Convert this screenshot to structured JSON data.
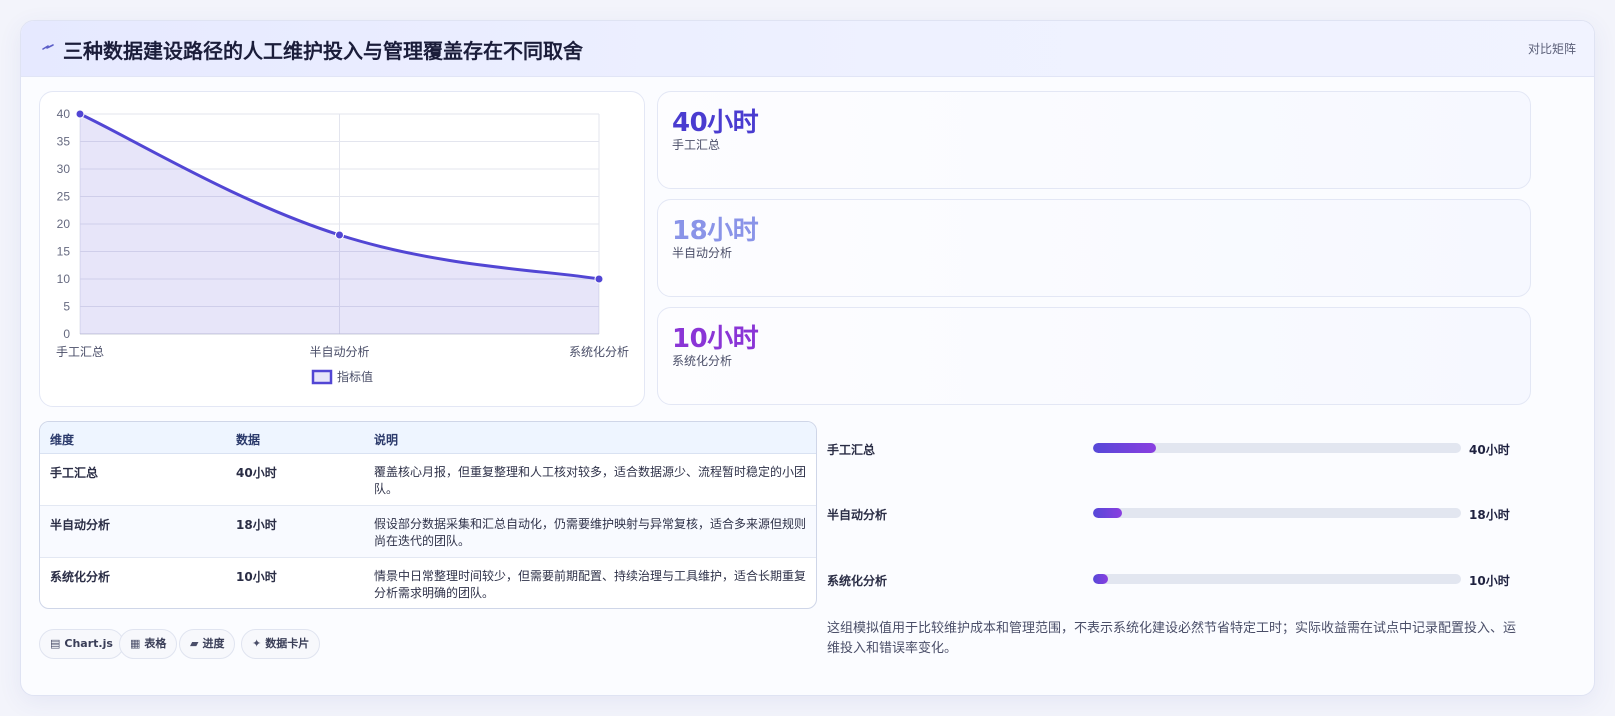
{
  "header": {
    "icon": "bolt-icon",
    "title": "三种数据建设路径的人工维护投入与管理覆盖存在不同取舍",
    "tag": "对比矩阵"
  },
  "chart_data": {
    "type": "line",
    "categories": [
      "手工汇总",
      "半自动分析",
      "系统化分析"
    ],
    "series": [
      {
        "name": "指标值",
        "values": [
          40,
          18,
          10
        ],
        "color": "#5246d4",
        "fill": "rgba(82,70,212,0.14)"
      }
    ],
    "yticks": [
      0,
      5,
      10,
      15,
      20,
      25,
      30,
      35,
      40
    ],
    "ylim": [
      0,
      40
    ],
    "grid": true,
    "legend_position": "bottom"
  },
  "stats": [
    {
      "value": "40小时",
      "label": "手工汇总",
      "color": "#4a3cd0"
    },
    {
      "value": "18小时",
      "label": "半自动分析",
      "color": "#8a94e8"
    },
    {
      "value": "10小时",
      "label": "系统化分析",
      "color": "#8a35d6"
    }
  ],
  "table": {
    "headers": [
      "维度",
      "数据",
      "说明"
    ],
    "rows": [
      {
        "dim": "手工汇总",
        "data": "40小时",
        "desc": "覆盖核心月报，但重复整理和人工核对较多，适合数据源少、流程暂时稳定的小团队。"
      },
      {
        "dim": "半自动分析",
        "data": "18小时",
        "desc": "假设部分数据采集和汇总自动化，仍需要维护映射与异常复核，适合多来源但规则尚在迭代的团队。"
      },
      {
        "dim": "系统化分析",
        "data": "10小时",
        "desc": "情景中日常整理时间较少，但需要前期配置、持续治理与工具维护，适合长期重复分析需求明确的团队。"
      }
    ]
  },
  "chips": [
    {
      "icon": "▤",
      "icon_name": "chart-icon",
      "label": "Chart.js"
    },
    {
      "icon": "▦",
      "icon_name": "table-icon",
      "label": "表格"
    },
    {
      "icon": "▰",
      "icon_name": "progress-icon",
      "label": "进度"
    },
    {
      "icon": "✦",
      "icon_name": "sparkle-icon",
      "label": "数据卡片"
    }
  ],
  "progress": [
    {
      "label": "手工汇总",
      "value": "40小时",
      "fraction": 0.17
    },
    {
      "label": "半自动分析",
      "value": "18小时",
      "fraction": 0.08
    },
    {
      "label": "系统化分析",
      "value": "10小时",
      "fraction": 0.04
    }
  ],
  "note": "这组模拟值用于比较维护成本和管理范围，不表示系统化建设必然节省特定工时；实际收益需在试点中记录配置投入、运维投入和错误率变化。"
}
